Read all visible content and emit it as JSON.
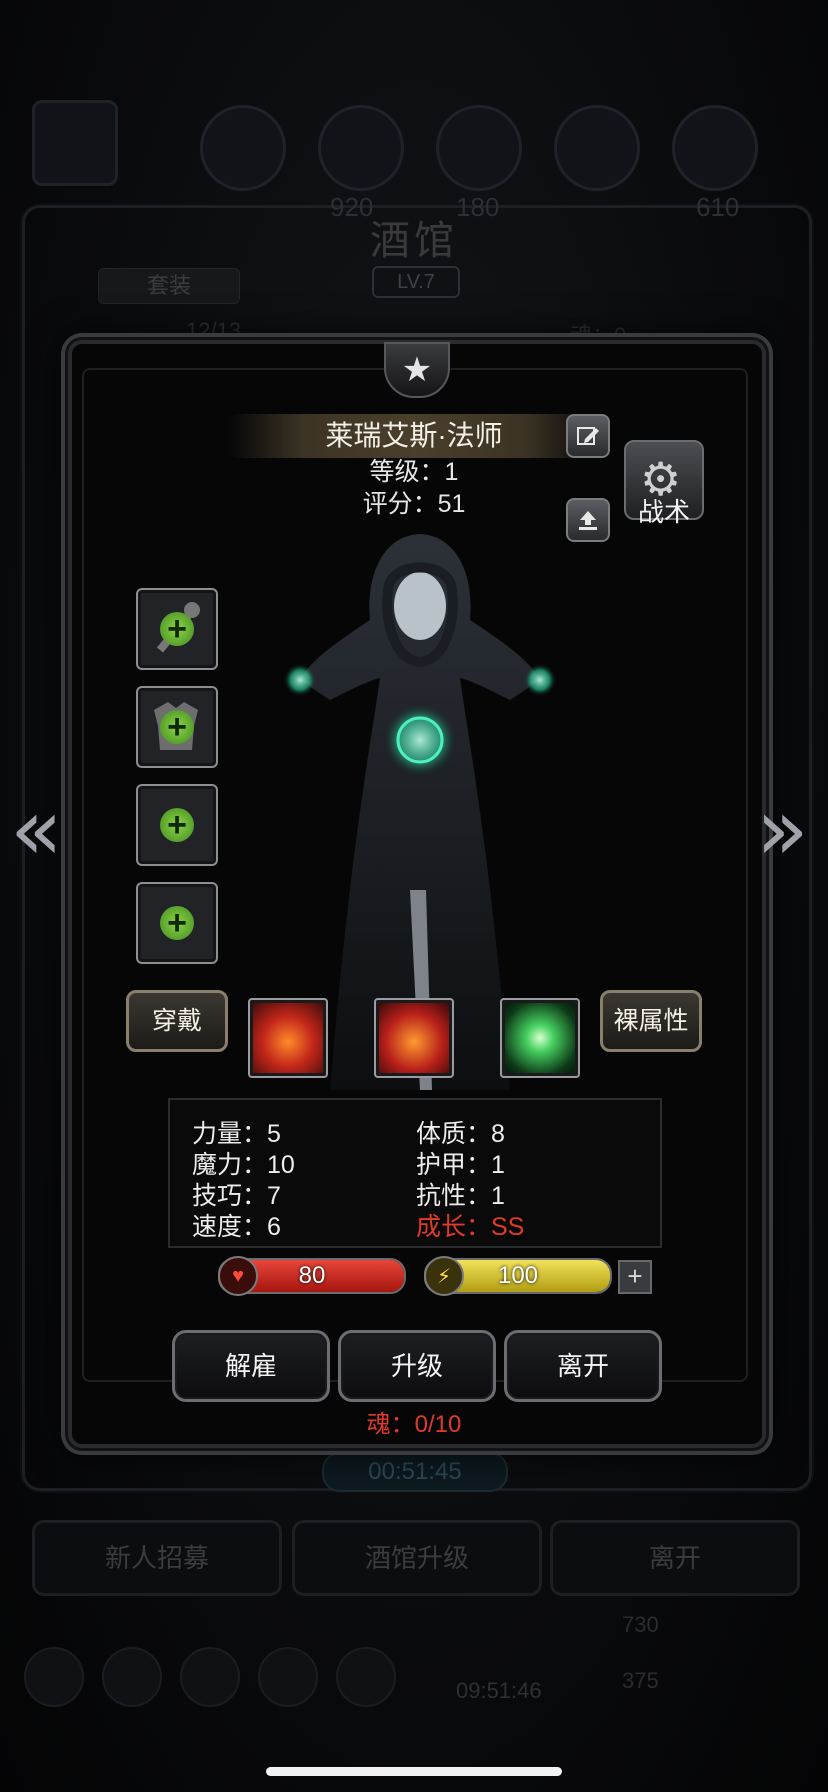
{
  "background": {
    "title": "酒馆",
    "level": "LV.7",
    "tab_set": "套装",
    "left_counter": "12/13",
    "soul_counter": "魂：0",
    "res_values": [
      "920",
      "180",
      "610"
    ],
    "timer": "00:51:45",
    "buttons": [
      "新人招募",
      "酒馆升级",
      "离开"
    ],
    "clock": "09:51:46",
    "currency": [
      "730",
      "375"
    ]
  },
  "hero": {
    "name": "莱瑞艾斯·法师",
    "level_line": "等级：1",
    "score_line": "评分：51",
    "tactics_label": "战术"
  },
  "equipment": {
    "slots": [
      "weapon",
      "armor",
      "accessory",
      "accessory"
    ],
    "wear_label": "穿戴",
    "naked_label": "裸属性"
  },
  "skills": [
    "fire-skill",
    "flame-skill",
    "green-crystal-skill"
  ],
  "stats": {
    "left": [
      "力量：5",
      "魔力：10",
      "技巧：7",
      "速度：6"
    ],
    "right": [
      "体质：8",
      "护甲：1",
      "抗性：1"
    ],
    "growth": "成长：SS"
  },
  "bars": {
    "hp": "80",
    "energy": "100",
    "hp_fill": 1.0,
    "energy_fill": 1.0
  },
  "actions": {
    "dismiss": "解雇",
    "upgrade": "升级",
    "leave": "离开"
  },
  "soul": "魂：0/10",
  "colors": {
    "hp": "#c7231b",
    "energy": "#d9c52a",
    "growth": "#e03a2a",
    "plus_green": "#6cc02f"
  }
}
